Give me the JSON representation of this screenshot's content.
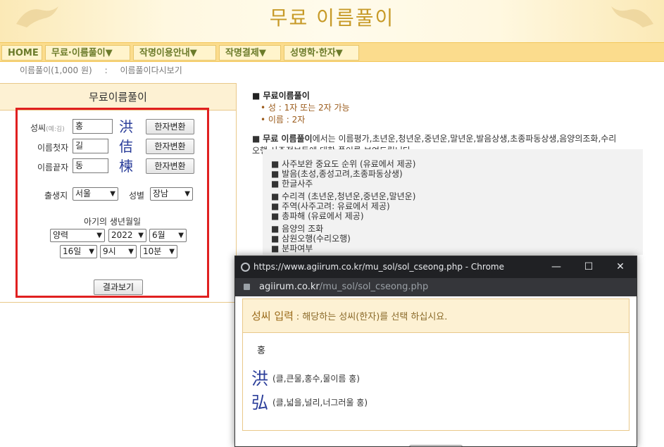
{
  "header": {
    "title": "무료 이름풀이"
  },
  "nav": [
    "HOME",
    "무료·이름풀이▼",
    "작명이용안내▼",
    "작명결제▼",
    "성명학·한자▼"
  ],
  "sub_links": [
    "이름풀이(1,000 원)",
    ":",
    "이름풀이다시보기"
  ],
  "form": {
    "heading": "무료이름풀이",
    "surname_label": "성씨",
    "surname_hint": "(예:김)",
    "surname_value": "홍",
    "surname_hanja": "洪",
    "first_label": "이름첫자",
    "first_value": "길",
    "first_hanja": "佶",
    "last_label": "이름끝자",
    "last_value": "동",
    "last_hanja": "楝",
    "convert_btn": "한자변환",
    "birthplace_label": "출생지",
    "birthplace_value": "서울",
    "gender_label": "성별",
    "gender_value": "장남",
    "birth_label": "아기의 생년월일",
    "calendar_value": "양력",
    "year_value": "2022",
    "month_value": "6월",
    "day_value": "16일",
    "hour_value": "9시",
    "minute_value": "10분",
    "submit_btn": "결과보기"
  },
  "info": {
    "h1": "■ 무료이름풀이",
    "b1": "• 성 : 1자 또는 2자 가능",
    "b2": "• 이름 : 2자",
    "p_prefix": "■ ",
    "p_strong": "무료 이름풀이",
    "p_line1": "에서는 이름평가,초년운,청년운,중년운,말년운,발음상생,초종파동상생,음양의조화,수리",
    "p_line2": "오행,사주정보등에 대한 풀이를 보여드립니다.",
    "list": [
      "■ 사주보완 중요도 순위 (유료에서 제공)",
      "■ 발음(초성,종성고려,초종파동상생)",
      "■ 한글사주",
      "■ 수리격 (초년운,청년운,중년운,말년운)",
      "■ 주역(사주고려: 유료에서 제공)",
      "■ 총파해 (유료에서 제공)",
      "■ 음양의 조화",
      "■ 삼원오행(수리오행)",
      "■ 분파여부"
    ]
  },
  "popup": {
    "window_title": "https://www.agiirum.co.kr/mu_sol/sol_cseong.php - Chrome",
    "url_domain": "agiirum.co.kr",
    "url_path": "/mu_sol/sol_cseong.php",
    "minimize": "—",
    "maximize": "☐",
    "close": "✕",
    "head_a": "성씨 입력",
    "head_b": ": 해당하는 성씨(한자)를 선택 하십시요.",
    "surname": "홍",
    "options": [
      {
        "hanja": "洪",
        "desc": "(클,큰물,홍수,물이름 홍)"
      },
      {
        "hanja": "弘",
        "desc": "(클,넓을,널리,너그러울 홍)"
      }
    ]
  }
}
